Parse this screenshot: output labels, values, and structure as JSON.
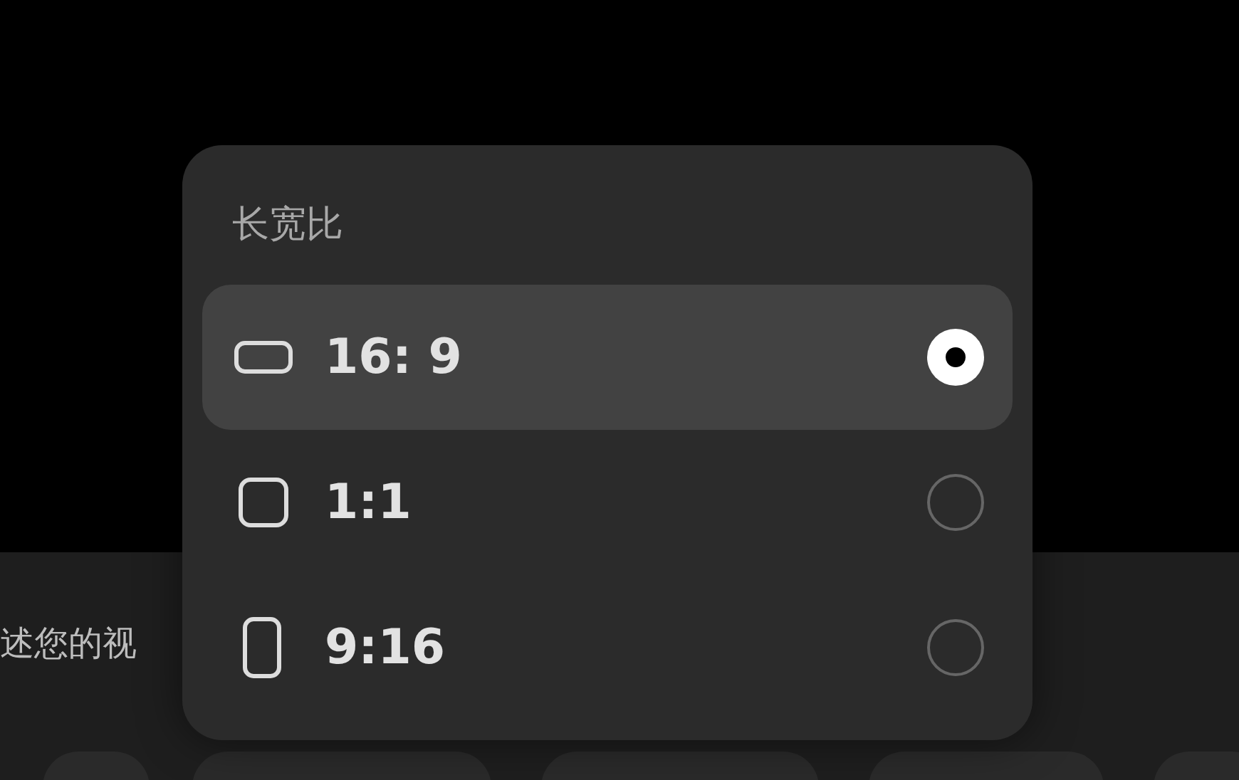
{
  "prompt": {
    "text": "述您的视"
  },
  "aspect_menu": {
    "title": "长宽比",
    "options": [
      {
        "kind": "landscape",
        "label": "16: 9",
        "selected": true
      },
      {
        "kind": "square",
        "label": "1:1",
        "selected": false
      },
      {
        "kind": "portrait",
        "label": "9:16",
        "selected": false
      }
    ]
  }
}
